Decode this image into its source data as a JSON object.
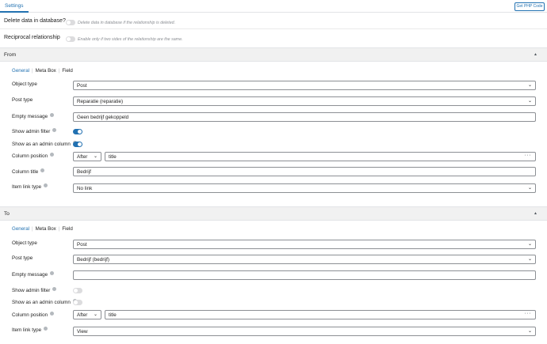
{
  "header": {
    "tab": "Settings",
    "php_button": "Get PHP Code"
  },
  "global": {
    "delete_label": "Delete data in database?",
    "delete_hint": "Delete data in database if the relationship is deleted.",
    "reciprocal_label": "Reciprocal relationship",
    "reciprocal_hint": "Enable only if two sides of the relationship are the same."
  },
  "from": {
    "title": "From",
    "tabs": [
      "General",
      "Meta Box",
      "Field"
    ],
    "labels": {
      "object_type": "Object type",
      "post_type": "Post type",
      "empty_message": "Empty message",
      "admin_filter": "Show admin filter",
      "admin_column": "Show as an admin column",
      "column_position": "Column position",
      "column_title": "Column title",
      "item_link_type": "Item link type"
    },
    "values": {
      "object_type": "Post",
      "post_type": "Reparatie (reparatie)",
      "empty_message": "Geen bedrijf gekoppeld",
      "admin_filter": true,
      "admin_column": true,
      "column_position": "After",
      "column_position_target": "title",
      "column_title": "Bedrijf",
      "item_link_type": "No link"
    }
  },
  "to": {
    "title": "To",
    "tabs": [
      "General",
      "Meta Box",
      "Field"
    ],
    "labels": {
      "object_type": "Object type",
      "post_type": "Post type",
      "empty_message": "Empty message",
      "admin_filter": "Show admin filter",
      "admin_column": "Show as an admin column",
      "column_position": "Column position",
      "item_link_type": "Item link type"
    },
    "values": {
      "object_type": "Post",
      "post_type": "Bedrijf (bedrijf)",
      "empty_message": "",
      "admin_filter": false,
      "admin_column": false,
      "column_position": "After",
      "column_position_target": "title",
      "item_link_type": "View"
    }
  },
  "colors": {
    "accent": "#2271b1",
    "toggle_off": "#dcdcde",
    "section_bg": "#f1f1f1"
  },
  "icons": {
    "info": "info-icon",
    "chevron": "chevron-down-icon",
    "collapse": "caret-up-icon",
    "more": "ellipsis-icon"
  }
}
